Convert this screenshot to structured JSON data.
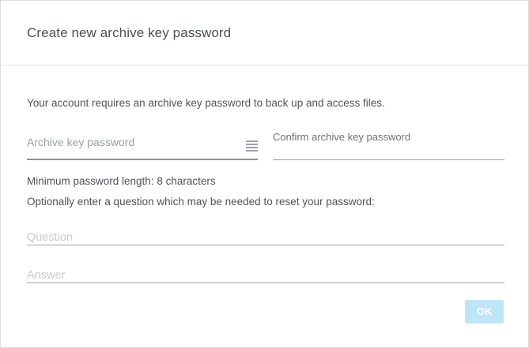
{
  "dialog": {
    "title": "Create new archive key password",
    "intro": "Your account requires an archive key password to back up and access files.",
    "password_field": {
      "placeholder": "Archive key password",
      "value": "",
      "strength_icon": "strength-meter-icon"
    },
    "confirm_field": {
      "label": "Confirm archive key password",
      "value": ""
    },
    "min_length_text": "Minimum password length: 8 characters",
    "question_prompt": "Optionally enter a question which may be needed to reset your password:",
    "question_field": {
      "placeholder": "Question",
      "value": ""
    },
    "answer_field": {
      "placeholder": "Answer",
      "value": ""
    },
    "ok_label": "OK",
    "colors": {
      "ok_disabled_bg": "#bfe6f8",
      "text": "#4f5358",
      "placeholder": "#c8ccd0"
    }
  }
}
